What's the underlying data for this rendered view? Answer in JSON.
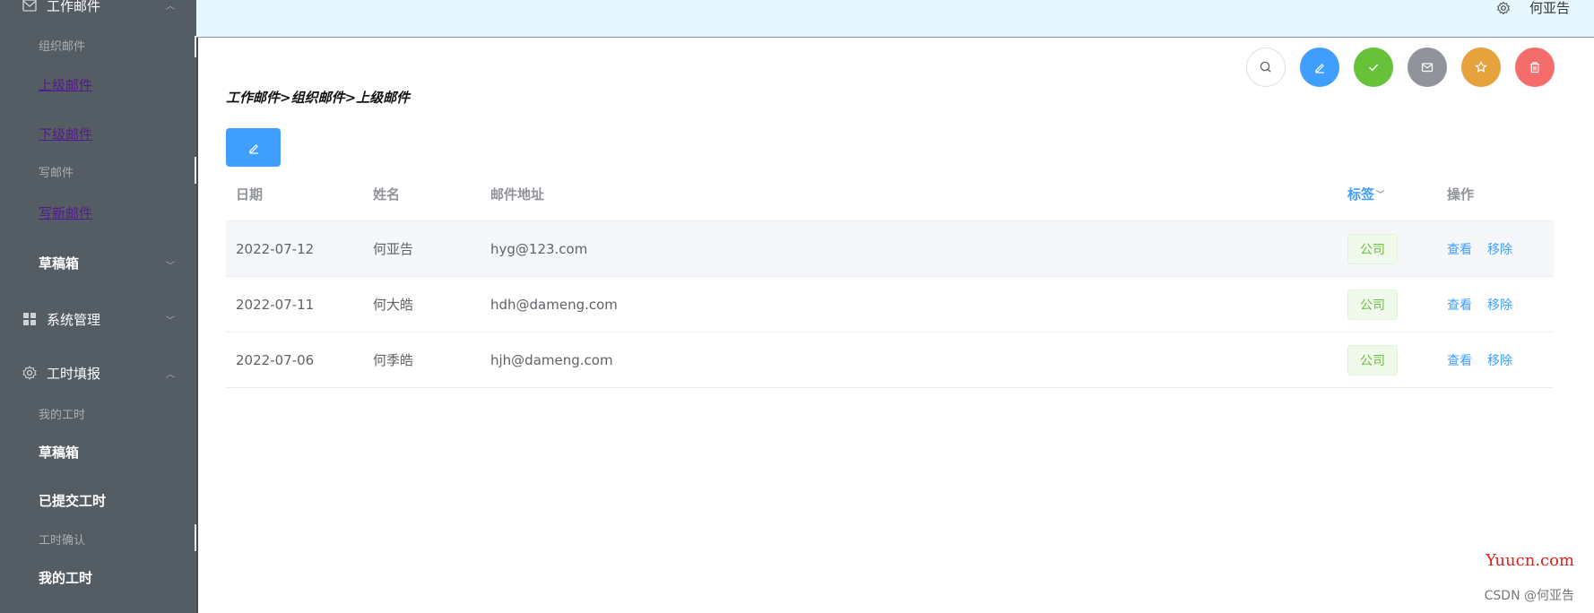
{
  "sidebar": {
    "group_mail": {
      "title": "工作邮件",
      "icon": "mail-icon"
    },
    "org_mail": "组织邮件",
    "upper_mail": "上级邮件",
    "lower_mail": "下级邮件",
    "write_mail": "写邮件",
    "write_new_mail": "写新邮件",
    "drafts": "草稿箱",
    "system": {
      "title": "系统管理",
      "icon": "grid-icon"
    },
    "timesheet": {
      "title": "工时填报",
      "icon": "gear-icon"
    },
    "my_hours": "我的工时",
    "drafts2": "草稿箱",
    "submitted": "已提交工时",
    "confirm": "工时确认",
    "my_hours2": "我的工时"
  },
  "header": {
    "user": "何亚告"
  },
  "breadcrumb": "工作邮件>组织邮件>上级邮件",
  "table": {
    "headers": {
      "date": "日期",
      "name": "姓名",
      "address": "邮件地址",
      "tag": "标签",
      "op": "操作"
    },
    "rows": [
      {
        "date": "2022-07-12",
        "name": "何亚告",
        "address": "hyg@123.com",
        "tag": "公司",
        "view": "查看",
        "remove": "移除"
      },
      {
        "date": "2022-07-11",
        "name": "何大皓",
        "address": "hdh@dameng.com",
        "tag": "公司",
        "view": "查看",
        "remove": "移除"
      },
      {
        "date": "2022-07-06",
        "name": "何季皓",
        "address": "hjh@dameng.com",
        "tag": "公司",
        "view": "查看",
        "remove": "移除"
      }
    ]
  },
  "colors": {
    "search": "#ffffff",
    "edit": "#409eff",
    "check": "#67c23a",
    "message": "#909399",
    "star": "#e6a23c",
    "delete": "#f56c6c"
  },
  "watermark": "Yuucn.com",
  "csdn": "CSDN @何亚告"
}
